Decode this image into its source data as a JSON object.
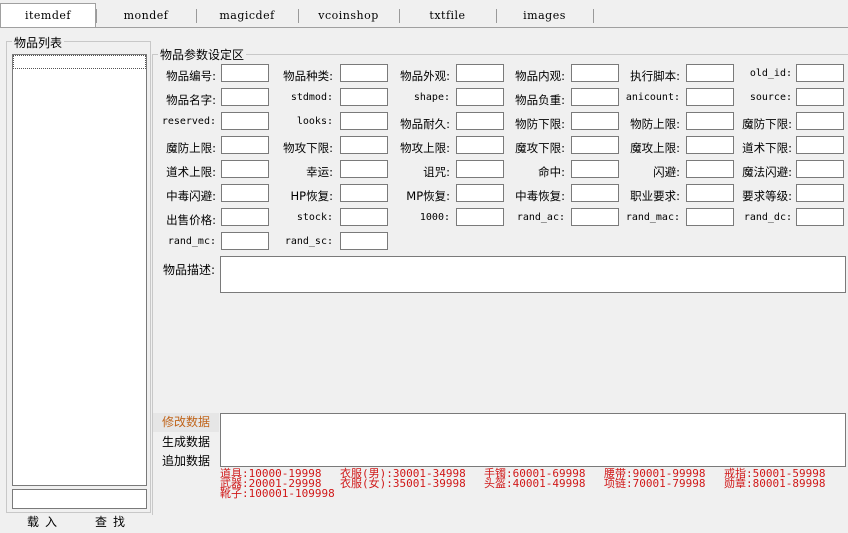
{
  "tabs": [
    "itemdef",
    "mondef",
    "magicdef",
    "vcoinshop",
    "txtfile",
    "images"
  ],
  "left_panel": {
    "title": "物品列表",
    "load_button": "载入",
    "find_button": "查找"
  },
  "right_panel": {
    "title": "物品参数设定区",
    "fields": [
      [
        "物品编号:",
        "物品种类:",
        "物品外观:",
        "物品内观:",
        "执行脚本:",
        "old_id:"
      ],
      [
        "物品名字:",
        "stdmod:",
        "shape:",
        "物品负重:",
        "anicount:",
        "source:"
      ],
      [
        "reserved:",
        "looks:",
        "物品耐久:",
        "物防下限:",
        "物防上限:",
        "魔防下限:"
      ],
      [
        "魔防上限:",
        "物攻下限:",
        "物攻上限:",
        "魔攻下限:",
        "魔攻上限:",
        "道术下限:"
      ],
      [
        "道术上限:",
        "幸运:",
        "诅咒:",
        "命中:",
        "闪避:",
        "魔法闪避:"
      ],
      [
        "中毒闪避:",
        "HP恢复:",
        "MP恢复:",
        "中毒恢复:",
        "职业要求:",
        "要求等级:"
      ],
      [
        "出售价格:",
        "stock:",
        "1000:",
        "rand_ac:",
        "rand_mac:",
        "rand_dc:"
      ],
      [
        "rand_mc:",
        "rand_sc:"
      ]
    ],
    "description_label": "物品描述:",
    "actions": [
      "修改数据",
      "生成数据",
      "追加数据"
    ],
    "ranges": [
      "道具:10000-19998",
      "衣服(男):30001-34998",
      "手镯:60001-69998",
      "腰带:90001-99998",
      "戒指:50001-59998",
      "武器:20001-29998",
      "衣服(女):35001-39998",
      "头盔:40001-49998",
      "项链:70001-79998",
      "勋章:80001-89998",
      "靴子:100001-109998"
    ]
  }
}
